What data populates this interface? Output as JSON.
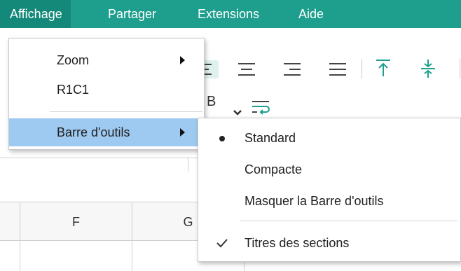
{
  "menubar": {
    "items": [
      "Affichage",
      "Partager",
      "Extensions",
      "Aide"
    ]
  },
  "colors": {
    "menubar_bg": "#1e9e8d",
    "menubar_active": "#14897a",
    "highlight": "#9ec9f0"
  },
  "toolbar": {
    "icons": [
      "align-left-icon",
      "align-center-icon",
      "align-right-icon",
      "justify-icon",
      "align-top-icon",
      "align-middle-icon",
      "bold-icon",
      "chevron-down-icon",
      "wrap-text-icon"
    ],
    "partial_label": "B"
  },
  "grid": {
    "columns": [
      "F",
      "G"
    ]
  },
  "view_menu": {
    "items": [
      {
        "label": "Zoom",
        "submenu": true
      },
      {
        "label": "R1C1",
        "submenu": false
      },
      {
        "label": "Barre d'outils",
        "submenu": true,
        "highlighted": true
      }
    ]
  },
  "toolbar_submenu": {
    "items": [
      {
        "label": "Standard",
        "state": "selected-bullet"
      },
      {
        "label": "Compacte",
        "state": "none"
      },
      {
        "label": "Masquer la Barre d'outils",
        "state": "none"
      },
      {
        "label": "Titres des sections",
        "state": "checked"
      }
    ]
  }
}
